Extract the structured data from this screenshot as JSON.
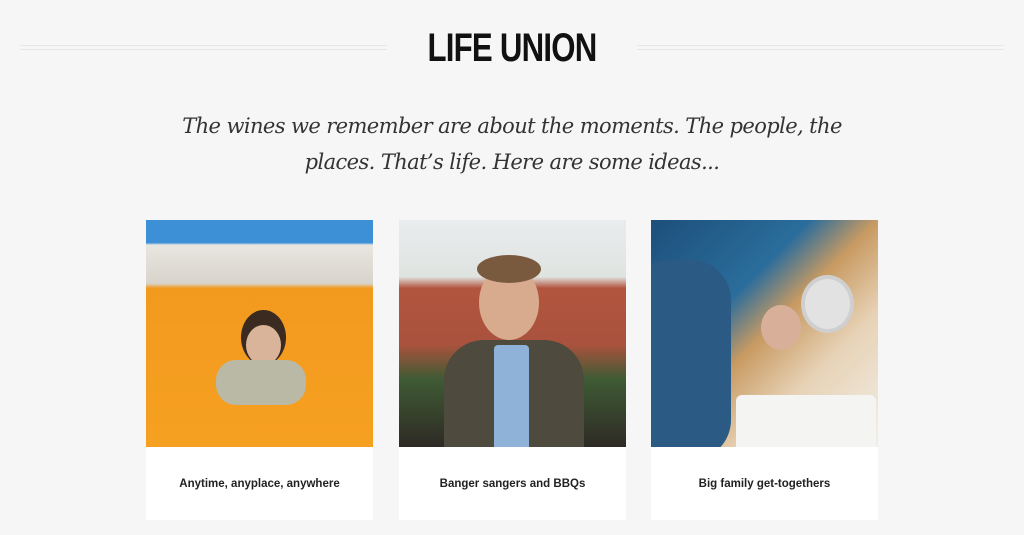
{
  "section": {
    "title": "LIFE UNION",
    "intro": "The wines we remember are about the moments. The people, the places. That’s life. Here are some ideas..."
  },
  "cards": [
    {
      "caption": "Anytime, anyplace, anywhere",
      "image": "woman-in-orange-van-photo"
    },
    {
      "caption": "Banger sangers and BBQs",
      "image": "man-eating-sausage-photo"
    },
    {
      "caption": "Big family get-togethers",
      "image": "family-dinner-photo"
    }
  ]
}
